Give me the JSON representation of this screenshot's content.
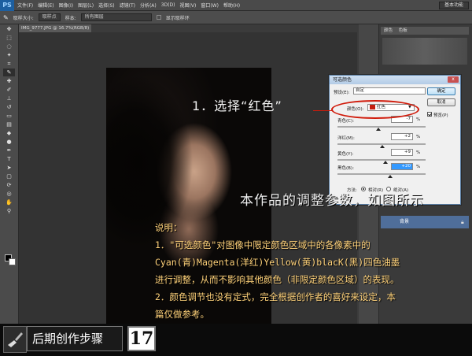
{
  "app": {
    "logo": "PS",
    "menus": [
      "文件(F)",
      "编辑(E)",
      "图像(I)",
      "图层(L)",
      "选择(S)",
      "滤镜(T)",
      "分析(A)",
      "3D(D)",
      "视图(V)",
      "窗口(W)",
      "帮助(H)"
    ],
    "workspace_button": "基本功能"
  },
  "options_bar": {
    "sample_size_label": "取样大小:",
    "sample_size_value": "取样点",
    "sample_label": "样本:",
    "sample_value": "所有图层",
    "ring_label": "显示取样环"
  },
  "document": {
    "tab_title": "IMG_9777.JPG @ 16.7%(RGB/8) *"
  },
  "panels": {
    "color_tab": "颜色",
    "swatch_tab": "色板",
    "layer_name": "背景"
  },
  "dialog": {
    "title": "可选颜色",
    "close_label": "x",
    "preset_label": "预设(E):",
    "preset_value": "自定",
    "colors_label": "颜色(O):",
    "colors_value": "红色",
    "chip_color": "#c41d0f",
    "sliders": [
      {
        "label": "青色(C):",
        "value": "-7",
        "unit": "%",
        "position": 0.465
      },
      {
        "label": "洋红(M):",
        "value": "+2",
        "unit": "%",
        "position": 0.51
      },
      {
        "label": "黄色(Y):",
        "value": "+9",
        "unit": "%",
        "position": 0.545
      },
      {
        "label": "黑色(B):",
        "value": "+20",
        "unit": "%",
        "position": 0.6
      }
    ],
    "ok_label": "确定",
    "cancel_label": "取消",
    "preview_label": "预览(P)",
    "method_label": "方法:",
    "relative_label": "相对(R)",
    "absolute_label": "绝对(A)"
  },
  "annotations": {
    "step1": "1．选择“红色”",
    "headline": "本作品的调整参数，如图所示",
    "desc": [
      "说明：",
      "1．\"可选颜色\"对图像中限定颜色区域中的各像素中的",
      "Cyan(青)Magenta(洋红)Yellow(黄)blacK(黑)四色油墨",
      "进行调整，从而不影响其他颜色（非限定颜色区域）的表现。",
      "2．颜色调节也没有定式，完全根据创作者的喜好来设定，本",
      "篇仅做参考。"
    ]
  },
  "footer": {
    "title": "后期创作步骤",
    "step": "17"
  },
  "colors": {
    "accent_red": "#d01a0a",
    "desc_text": "#ffd27a"
  }
}
